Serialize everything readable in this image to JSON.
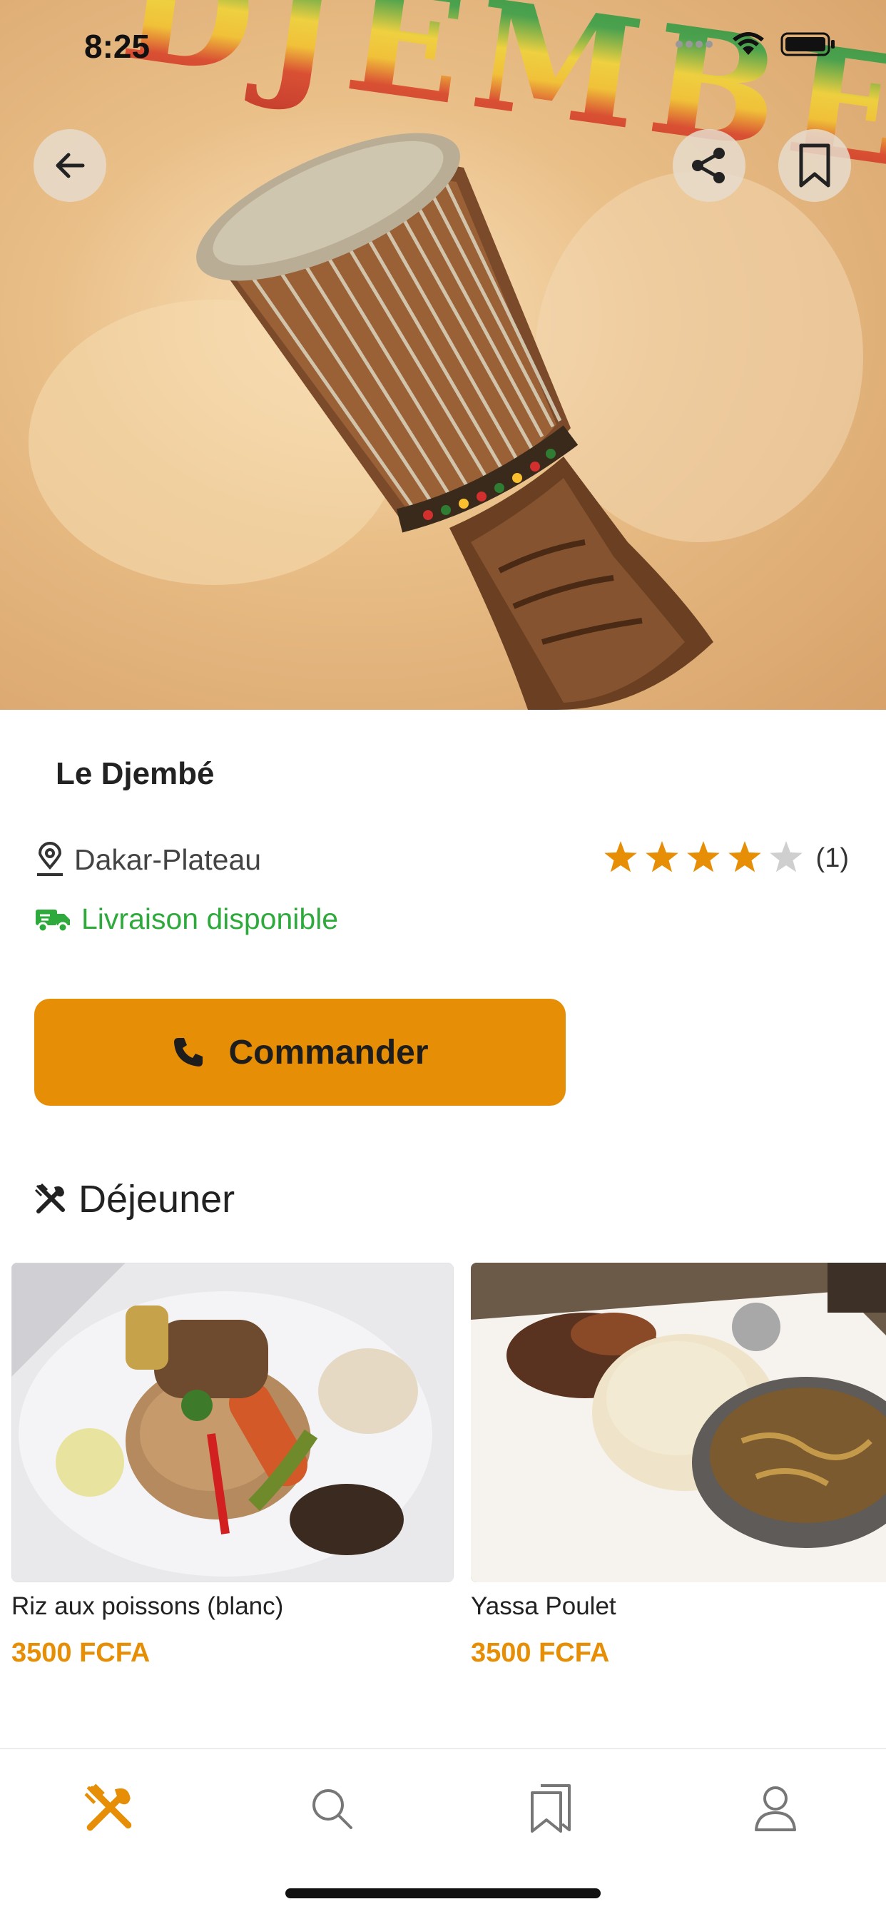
{
  "status_bar": {
    "time": "8:25"
  },
  "hero": {
    "sign_text": "DJEMBE",
    "back_icon": "arrow-left-icon",
    "share_icon": "share-icon",
    "bookmark_icon": "bookmark-icon"
  },
  "restaurant": {
    "name": "Le Djembé",
    "location": "Dakar-Plateau",
    "rating": 4,
    "rating_max": 5,
    "rating_count": "(1)",
    "delivery": "Livraison disponible"
  },
  "order_button": {
    "label": "Commander",
    "icon": "phone-icon"
  },
  "menu_section": {
    "title": "Déjeuner",
    "icon": "utensils-icon",
    "items": [
      {
        "name": "Riz aux poissons (blanc)",
        "price": "3500 FCFA"
      },
      {
        "name": "Yassa Poulet",
        "price": "3500 FCFA"
      }
    ]
  },
  "tab_bar": {
    "tabs": [
      {
        "icon": "utensils-icon",
        "active": true
      },
      {
        "icon": "search-icon",
        "active": false
      },
      {
        "icon": "bookmarks-icon",
        "active": false
      },
      {
        "icon": "user-icon",
        "active": false
      }
    ]
  },
  "colors": {
    "accent": "#e68e05",
    "delivery_green": "#2eaa3c",
    "star_active": "#e68e05",
    "star_inactive": "#cfcfcf"
  }
}
